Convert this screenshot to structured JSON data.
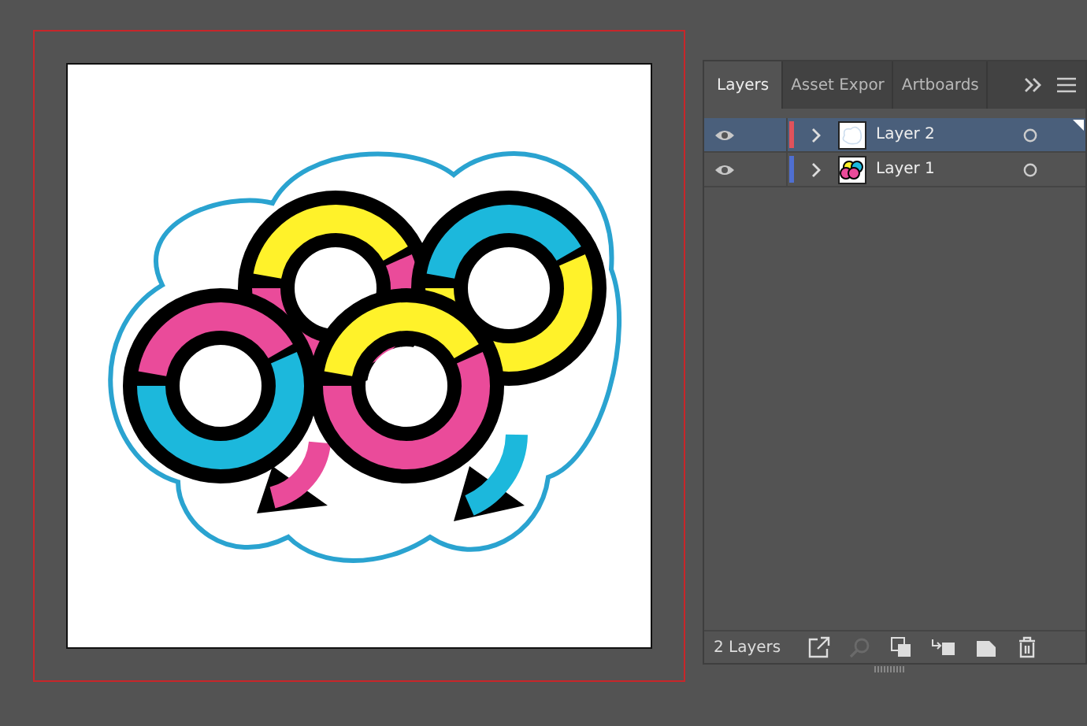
{
  "tabs": [
    {
      "label": "Layers",
      "selected": true
    },
    {
      "label": "Asset Expor",
      "selected": false
    },
    {
      "label": "Artboards",
      "selected": false
    }
  ],
  "layers": [
    {
      "name": "Layer 2",
      "color": "#e0525b",
      "selected": true,
      "kind": "outline"
    },
    {
      "name": "Layer 1",
      "color": "#4f6fd1",
      "selected": false,
      "kind": "art"
    }
  ],
  "footer": {
    "count": "2 Layers"
  }
}
